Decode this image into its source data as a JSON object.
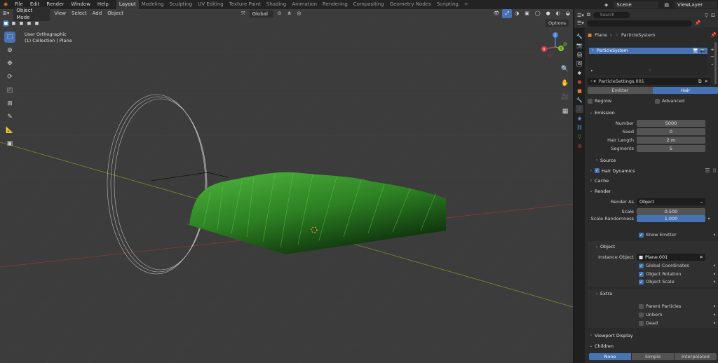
{
  "topbar": {
    "menus": [
      "File",
      "Edit",
      "Render",
      "Window",
      "Help"
    ],
    "workspaces": [
      "Layout",
      "Modeling",
      "Sculpting",
      "UV Editing",
      "Texture Paint",
      "Shading",
      "Animation",
      "Rendering",
      "Compositing",
      "Geometry Nodes",
      "Scripting"
    ],
    "active_workspace": "Layout",
    "scene": "Scene",
    "view_layer": "ViewLayer"
  },
  "viewport": {
    "mode": "Object Mode",
    "menus": [
      "View",
      "Select",
      "Add",
      "Object"
    ],
    "transform_orientation": "Global",
    "options_label": "Options",
    "overlay_title": "User Orthographic",
    "overlay_collection": "(1) Collection | Plane",
    "gizmo_axes": [
      "X",
      "Y",
      "Z"
    ]
  },
  "outliner": {
    "search_placeholder": "Search"
  },
  "properties": {
    "breadcrumb": [
      "Plane",
      "ParticleSystem"
    ],
    "particle_system_item": "ParticleSystem",
    "settings_name": "ParticleSettings.001",
    "type_tabs": [
      "Emitter",
      "Hair"
    ],
    "active_type": "Hair",
    "regrow_label": "Regrow",
    "advanced_label": "Advanced",
    "emission": {
      "header": "Emission",
      "number_label": "Number",
      "number": "5000",
      "seed_label": "Seed",
      "seed": "0",
      "hair_length_label": "Hair Length",
      "hair_length": "2 m",
      "segments_label": "Segments",
      "segments": "5"
    },
    "source_header": "Source",
    "hair_dynamics_header": "Hair Dynamics",
    "cache_header": "Cache",
    "render": {
      "header": "Render",
      "render_as_label": "Render As",
      "render_as": "Object",
      "scale_label": "Scale",
      "scale": "0.500",
      "scale_random_label": "Scale Randomness",
      "scale_random": "1.000",
      "show_emitter": "Show Emitter"
    },
    "object": {
      "header": "Object",
      "instance_object_label": "Instance Object",
      "instance_object": "Plane.001",
      "global_coordinates": "Global Coordinates",
      "object_rotation": "Object Rotation",
      "object_scale": "Object Scale"
    },
    "extra": {
      "header": "Extra",
      "parent_particles": "Parent Particles",
      "unborn": "Unborn",
      "dead": "Dead"
    },
    "viewport_display_header": "Viewport Display",
    "children": {
      "header": "Children",
      "options": [
        "None",
        "Simple",
        "Interpolated"
      ],
      "active": "None"
    }
  },
  "colors": {
    "accent": "#4772b3",
    "grass_light": "#3fa334",
    "grass_dark": "#123d10"
  }
}
